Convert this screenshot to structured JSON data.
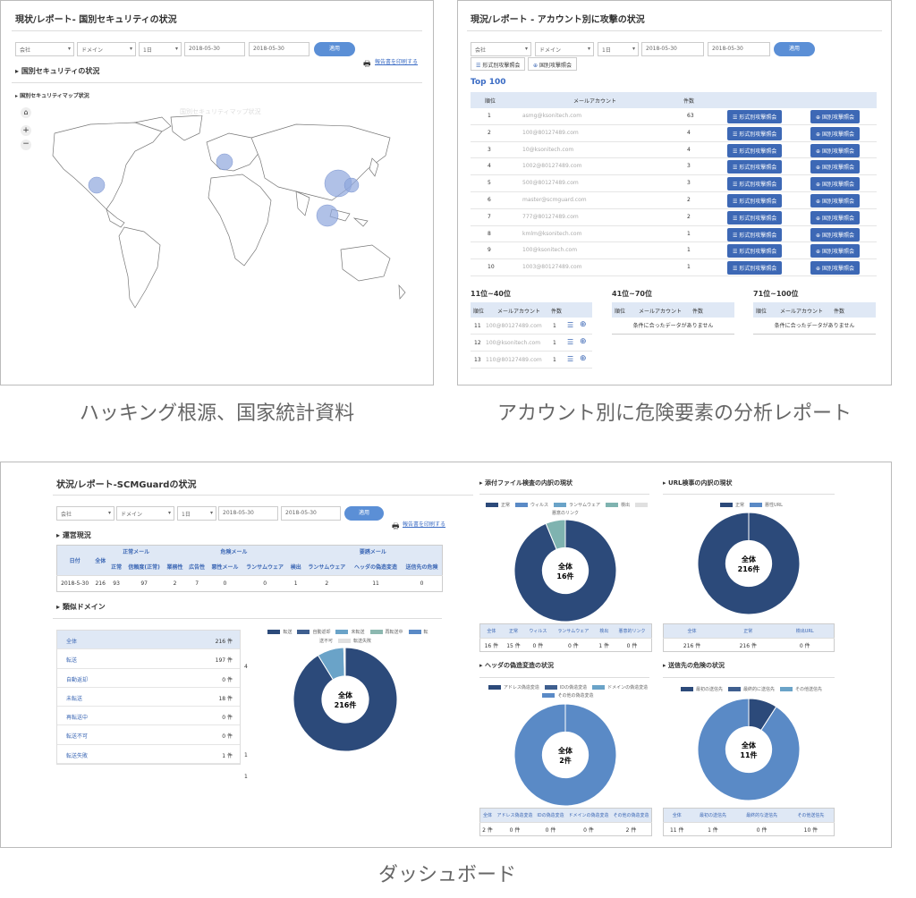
{
  "panel1": {
    "title": "現状/レポート- 国別セキュリティの状況",
    "filters": {
      "company": "会社",
      "domain": "ドメイン",
      "period": "1日",
      "date_from": "2018-05-30",
      "date_to": "2018-05-30",
      "apply": "適用"
    },
    "print_label": "報告書を印刷する",
    "section": "国別セキュリティの状況",
    "subsection": "国別セキュリティマップ状況",
    "map_title": "国別セキュリティマップ状況"
  },
  "panel2": {
    "title": "現況/レポート - アカウント別に攻撃の状況",
    "filters": {
      "company": "会社",
      "domain": "ドメイン",
      "period": "1日",
      "date_from": "2018-05-30",
      "date_to": "2018-05-30",
      "apply": "適用"
    },
    "tab_format": "形式別攻撃照会",
    "tab_country": "国別攻撃照会",
    "top_label": "Top 100",
    "columns": [
      "順位",
      "メールアカウント",
      "件数"
    ],
    "btn_format": "形式別攻撃照会",
    "btn_country": "国別攻撃照会",
    "rows": [
      {
        "rank": "1",
        "email": "asmg@ksonitech.com",
        "count": "63"
      },
      {
        "rank": "2",
        "email": "100@80127489.com",
        "count": "4"
      },
      {
        "rank": "3",
        "email": "10@ksonitech.com",
        "count": "4"
      },
      {
        "rank": "4",
        "email": "1002@80127489.com",
        "count": "3"
      },
      {
        "rank": "5",
        "email": "500@80127489.com",
        "count": "3"
      },
      {
        "rank": "6",
        "email": "master@scmguard.com",
        "count": "2"
      },
      {
        "rank": "7",
        "email": "777@80127489.com",
        "count": "2"
      },
      {
        "rank": "8",
        "email": "kmlm@ksonitech.com",
        "count": "1"
      },
      {
        "rank": "9",
        "email": "100@ksonitech.com",
        "count": "1"
      },
      {
        "rank": "10",
        "email": "1003@80127489.com",
        "count": "1"
      }
    ],
    "sub1": {
      "title": "11位~40位",
      "cols": [
        "順位",
        "メールアカウント",
        "件数"
      ],
      "rows": [
        {
          "rank": "11",
          "email": "100@80127489.com",
          "count": "1"
        },
        {
          "rank": "12",
          "email": "100@ksonitech.com",
          "count": "1"
        },
        {
          "rank": "13",
          "email": "110@80127489.com",
          "count": "1"
        }
      ]
    },
    "sub2": {
      "title": "41位~70位",
      "cols": [
        "順位",
        "メールアカウント",
        "件数"
      ],
      "empty": "条件に合ったデータがありません"
    },
    "sub3": {
      "title": "71位~100位",
      "cols": [
        "順位",
        "メールアカウント",
        "件数"
      ],
      "empty": "条件に合ったデータがありません"
    }
  },
  "panel3": {
    "title": "状況/レポート-SCMGuardの状況",
    "filters": {
      "company": "会社",
      "domain": "ドメイン",
      "period": "1日",
      "date_from": "2018-05-30",
      "date_to": "2018-05-30",
      "apply": "適用"
    },
    "print_label": "報告書を印刷する",
    "ops_section": "運営現況",
    "ops_table": {
      "date_h": "日付",
      "total_h": "全体",
      "normal_group": "正常メール",
      "danger_group": "危険メール",
      "suspect_group": "要誘メール",
      "sub_headers": [
        "正常",
        "信頼度(正常)",
        "業務性",
        "広告性",
        "悪性メール",
        "ランサムウェア",
        "検出",
        "ランサムウェア",
        "ヘッダの偽造変造",
        "送信先の危険"
      ],
      "row": [
        "2018-5-30",
        "216",
        "93",
        "97",
        "2",
        "7",
        "0",
        "0",
        "1",
        "2",
        "11",
        "0"
      ]
    },
    "domain_section": "類似ドメイン",
    "domain_list": [
      {
        "label": "全体",
        "value": "216 件"
      },
      {
        "label": "転送",
        "value": "197 件"
      },
      {
        "label": "自動返却",
        "value": "0 件"
      },
      {
        "label": "未転送",
        "value": "18 件"
      },
      {
        "label": "再転送中",
        "value": "0 件"
      },
      {
        "label": "転送不可",
        "value": "0 件"
      },
      {
        "label": "転送失敗",
        "value": "1 件"
      }
    ],
    "side_marks": [
      "4",
      "1",
      "1"
    ],
    "domain_legend": [
      "転送",
      "自動返却",
      "未転送",
      "再転送中",
      "転送不可",
      "転送失敗"
    ],
    "domain_donut": {
      "label": "全体",
      "value": "216件"
    },
    "attach": {
      "title": "添付ファイル検査の内訳の現状",
      "legend": [
        "正常",
        "ウィルス",
        "ランサムウェア",
        "検出",
        "悪意のリンク"
      ],
      "donut_label": "全体",
      "donut_value": "16件",
      "cols": [
        "全体",
        "正常",
        "ウィルス",
        "ランサムウェア",
        "検出",
        "悪意的リンク"
      ],
      "vals": [
        "16 件",
        "15 件",
        "0 件",
        "0 件",
        "1 件",
        "0 件"
      ]
    },
    "url": {
      "title": "URL検事の内訳の現状",
      "legend": [
        "正常",
        "悪性URL"
      ],
      "donut_label": "全体",
      "donut_value": "216件",
      "cols": [
        "全体",
        "正常",
        "検出URL"
      ],
      "vals": [
        "216 件",
        "216 件",
        "0 件"
      ]
    },
    "header": {
      "title": "ヘッダの偽造変造の状況",
      "legend": [
        "アドレス偽造変造",
        "IDの偽造変造",
        "ドメインの偽造変造",
        "その他の偽造変造"
      ],
      "donut_label": "全体",
      "donut_value": "2件",
      "cols": [
        "全体",
        "アドレス偽造変造",
        "IDの偽造変造",
        "ドメインの偽造変造",
        "その他の偽造変造"
      ],
      "vals": [
        "2 件",
        "0 件",
        "0 件",
        "0 件",
        "2 件"
      ]
    },
    "sender": {
      "title": "送信先の危険の状況",
      "legend": [
        "最初の送信先",
        "最終的に送信先",
        "その他送信先"
      ],
      "donut_label": "全体",
      "donut_value": "11件",
      "cols": [
        "全体",
        "最初の送信先",
        "最終的な送信先",
        "その他送信先"
      ],
      "vals": [
        "11 件",
        "1 件",
        "0 件",
        "10 件"
      ]
    }
  },
  "captions": {
    "c1": "ハッキング根源、国家統計資料",
    "c2": "アカウント別に危険要素の分析レポート",
    "c3": "ダッシュボード"
  },
  "colors": {
    "dark_navy": "#2c4a7a",
    "mid_blue": "#5a8ac6",
    "light_blue": "#8cb8d8",
    "teal": "#7fb3b0",
    "button_blue": "#3d68b5",
    "header_bg": "#dfe8f5",
    "bubble": "#8fa7dd"
  },
  "chart_data": [
    {
      "type": "pie",
      "title": "",
      "categories": [
        "転送",
        "自動返却",
        "未転送",
        "再転送中",
        "転送不可",
        "転送失敗"
      ],
      "values": [
        197,
        0,
        18,
        0,
        0,
        1
      ]
    },
    {
      "type": "pie",
      "title": "添付ファイル検査の内訳の現状",
      "categories": [
        "正常",
        "ウィルス",
        "ランサムウェア",
        "検出",
        "悪意のリンク"
      ],
      "values": [
        15,
        0,
        0,
        1,
        0
      ]
    },
    {
      "type": "pie",
      "title": "URL検事の内訳の現状",
      "categories": [
        "正常",
        "悪性URL"
      ],
      "values": [
        216,
        0
      ]
    },
    {
      "type": "pie",
      "title": "ヘッダの偽造変造の状況",
      "categories": [
        "アドレス偽造変造",
        "IDの偽造変造",
        "ドメインの偽造変造",
        "その他の偽造変造"
      ],
      "values": [
        0,
        0,
        0,
        2
      ]
    },
    {
      "type": "pie",
      "title": "送信先の危険の状況",
      "categories": [
        "最初の送信先",
        "最終的に送信先",
        "その他送信先"
      ],
      "values": [
        1,
        0,
        10
      ]
    }
  ]
}
